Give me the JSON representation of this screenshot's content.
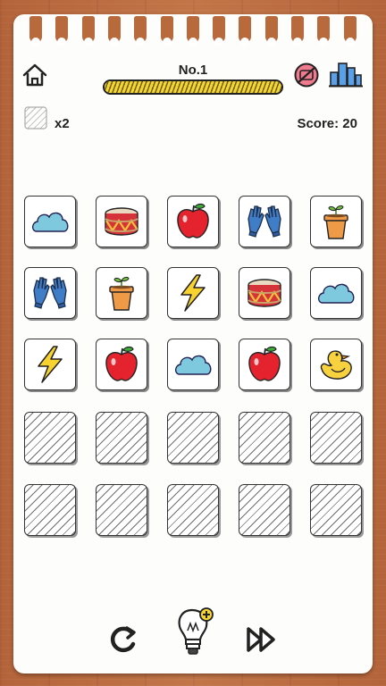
{
  "level": {
    "title": "No.1",
    "progress_percent": 100
  },
  "hint": {
    "count_text": "x2"
  },
  "score": {
    "text": "Score: 20"
  },
  "header_icons": [
    "home-icon",
    "no-ads-icon",
    "city-skyline-icon"
  ],
  "board": {
    "rows": [
      [
        "cloud",
        "drum",
        "apple",
        "gloves",
        "plant-pot"
      ],
      [
        "gloves",
        "plant-pot",
        "lightning",
        "drum",
        "cloud"
      ],
      [
        "lightning",
        "apple",
        "cloud",
        "apple",
        "duck"
      ],
      [
        "empty",
        "empty",
        "empty",
        "empty",
        "empty"
      ],
      [
        "empty",
        "empty",
        "empty",
        "empty",
        "empty"
      ]
    ]
  },
  "toolbar": [
    "undo-icon",
    "lightbulb-hint-icon",
    "fast-forward-icon"
  ]
}
